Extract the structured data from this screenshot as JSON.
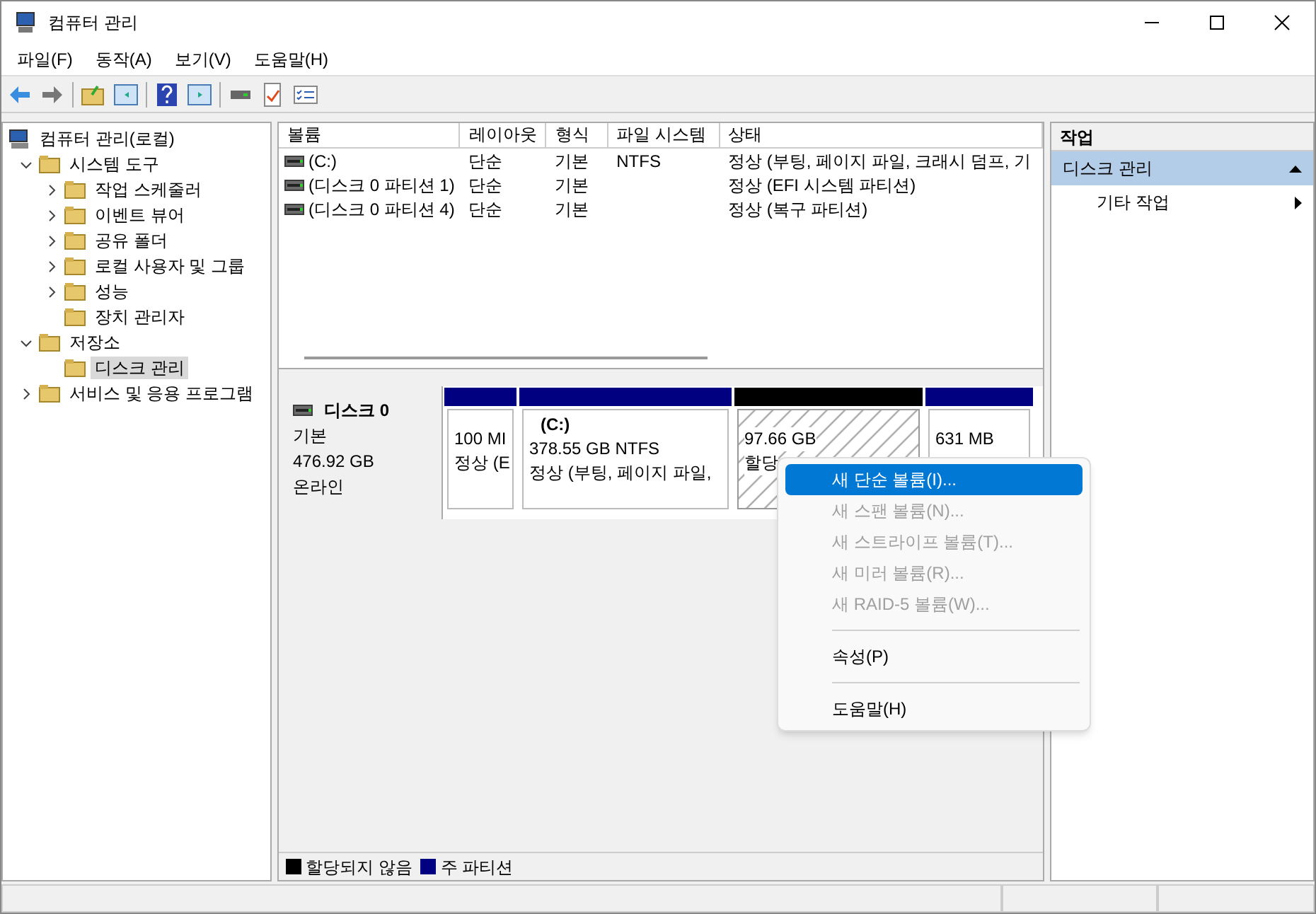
{
  "window": {
    "title": "컴퓨터 관리"
  },
  "menu": [
    "파일(F)",
    "동작(A)",
    "보기(V)",
    "도움말(H)"
  ],
  "tree": [
    {
      "label": "컴퓨터 관리(로컬)",
      "kind": "root",
      "selected": false,
      "children": [
        {
          "label": "시스템 도구",
          "kind": "group",
          "expanded": true,
          "selected": false,
          "children": [
            {
              "label": "작업 스케줄러",
              "kind": "group",
              "expanded": false,
              "selected": false
            },
            {
              "label": "이벤트 뷰어",
              "kind": "group",
              "expanded": false,
              "selected": false
            },
            {
              "label": "공유 폴더",
              "kind": "group",
              "expanded": false,
              "selected": false
            },
            {
              "label": "로컬 사용자 및 그룹",
              "kind": "group",
              "expanded": false,
              "selected": false
            },
            {
              "label": "성능",
              "kind": "group",
              "expanded": false,
              "selected": false
            },
            {
              "label": "장치 관리자",
              "kind": "leaf",
              "selected": false
            }
          ]
        },
        {
          "label": "저장소",
          "kind": "group",
          "expanded": true,
          "selected": false,
          "children": [
            {
              "label": "디스크 관리",
              "kind": "leaf",
              "selected": true
            }
          ]
        },
        {
          "label": "서비스 및 응용 프로그램",
          "kind": "group",
          "expanded": false,
          "selected": false
        }
      ]
    }
  ],
  "volume_table": {
    "columns": [
      "볼륨",
      "레이아웃",
      "형식",
      "파일 시스템",
      "상태"
    ],
    "rows": [
      [
        "(C:)",
        "단순",
        "기본",
        "NTFS",
        "정상 (부팅, 페이지 파일, 크래시 덤프, 기"
      ],
      [
        "(디스크 0 파티션 1)",
        "단순",
        "기본",
        "",
        "정상 (EFI 시스템 파티션)"
      ],
      [
        "(디스크 0 파티션 4)",
        "단순",
        "기본",
        "",
        "정상 (복구 파티션)"
      ]
    ]
  },
  "disk": {
    "name": "디스크 0",
    "type": "기본",
    "size": "476.92 GB",
    "status": "온라인",
    "partitions": [
      {
        "kind": "primary",
        "color": "#000080",
        "lines": [
          "100 MI",
          "정상 (E"
        ]
      },
      {
        "kind": "primary",
        "color": "#000080",
        "title": "(C:)",
        "lines": [
          "378.55 GB NTFS",
          "정상 (부팅, 페이지 파일,"
        ]
      },
      {
        "kind": "unallocated",
        "color": "#000000",
        "lines": [
          "97.66 GB",
          "할당"
        ]
      },
      {
        "kind": "primary",
        "color": "#000080",
        "lines": [
          "631 MB"
        ]
      }
    ]
  },
  "legend": [
    {
      "label": "할당되지 않음",
      "color": "#000000"
    },
    {
      "label": "주 파티션",
      "color": "#000080"
    }
  ],
  "context_menu": [
    {
      "kind": "item",
      "label": "새 단순 볼륨(I)...",
      "disabled": false,
      "selected": true
    },
    {
      "kind": "item",
      "label": "새 스팬 볼륨(N)...",
      "disabled": true,
      "selected": false
    },
    {
      "kind": "item",
      "label": "새 스트라이프 볼륨(T)...",
      "disabled": true,
      "selected": false
    },
    {
      "kind": "item",
      "label": "새 미러 볼륨(R)...",
      "disabled": true,
      "selected": false
    },
    {
      "kind": "item",
      "label": "새 RAID-5 볼륨(W)...",
      "disabled": true,
      "selected": false
    },
    {
      "kind": "separator"
    },
    {
      "kind": "item",
      "label": "속성(P)",
      "disabled": false,
      "selected": false
    },
    {
      "kind": "separator"
    },
    {
      "kind": "item",
      "label": "도움말(H)",
      "disabled": false,
      "selected": false
    }
  ],
  "actions": {
    "title": "작업",
    "section": {
      "label": "디스크 관리",
      "expanded": true
    },
    "items": [
      {
        "label": "기타 작업"
      }
    ]
  }
}
